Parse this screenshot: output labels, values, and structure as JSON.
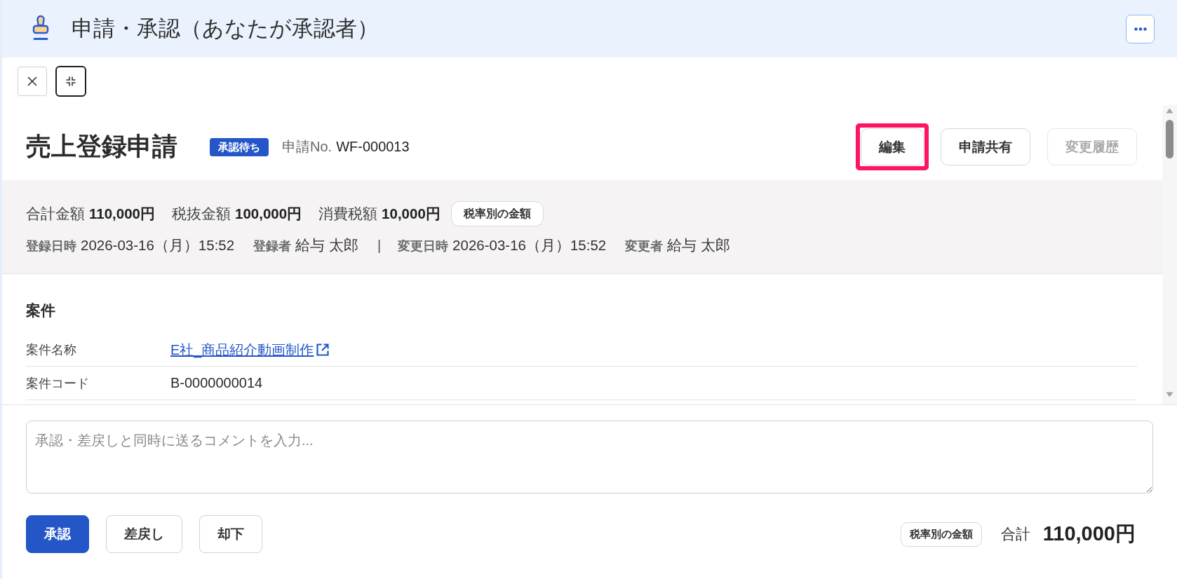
{
  "header": {
    "title": "申請・承認（あなたが承認者）"
  },
  "toolbar": {
    "buttons": [
      {
        "kind": "close",
        "focused": false
      },
      {
        "kind": "collapse",
        "focused": true
      }
    ]
  },
  "request": {
    "title": "売上登録申請",
    "status": "承認待ち",
    "number_label": "申請No.",
    "number": "WF-000013",
    "actions": [
      {
        "label": "編集",
        "disabled": false,
        "highlighted": true
      },
      {
        "label": "申請共有",
        "disabled": false,
        "highlighted": false
      },
      {
        "label": "変更履歴",
        "disabled": true,
        "highlighted": false
      }
    ]
  },
  "summary": {
    "amounts": [
      {
        "label": "合計金額",
        "value": "110,000円"
      },
      {
        "label": "税抜金額",
        "value": "100,000円"
      },
      {
        "label": "消費税額",
        "value": "10,000円"
      }
    ],
    "tax_button": "税率別の金額",
    "meta": [
      {
        "kind": "field",
        "label": "登録日時",
        "value": "2026-03-16（月）15:52"
      },
      {
        "kind": "field",
        "label": "登録者",
        "value": "給与 太郎"
      },
      {
        "kind": "separator",
        "text": "|"
      },
      {
        "kind": "field",
        "label": "変更日時",
        "value": "2026-03-16（月）15:52"
      },
      {
        "kind": "field",
        "label": "変更者",
        "value": "給与 太郎"
      }
    ]
  },
  "case": {
    "heading": "案件",
    "rows": [
      {
        "kind": "link",
        "label": "案件名称",
        "value": "E社_商品紹介動画制作"
      },
      {
        "kind": "text",
        "label": "案件コード",
        "value": "B-0000000014"
      }
    ]
  },
  "comment": {
    "placeholder": "承認・差戻しと同時に送るコメントを入力..."
  },
  "decision_buttons": [
    {
      "label": "承認",
      "primary": true
    },
    {
      "label": "差戻し",
      "primary": false
    },
    {
      "label": "却下",
      "primary": false
    }
  ],
  "total": {
    "tax_button": "税率別の金額",
    "label": "合計",
    "value": "110,000円"
  }
}
